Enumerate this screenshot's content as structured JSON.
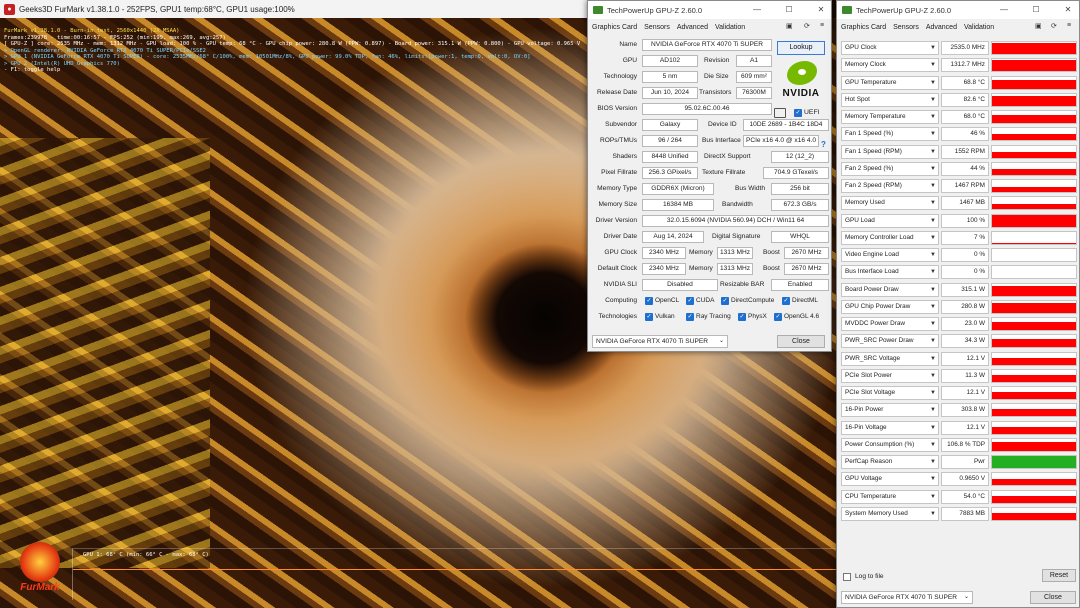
{
  "furmark": {
    "title": "Geeks3D FurMark v1.38.1.0 - 252FPS, GPU1 temp:68°C, GPU1 usage:100%",
    "overlay": [
      "FurMark v1.38.1.0 - Burn-in test, 2560x1440 (2X MSAA)",
      "Frames:239978 - time:00:16:57 - FPS:252 (min:199, max:269, avg:257)",
      "[ GPU-Z ] core: 2535 MHz - mem: 1312 MHz - GPU load: 100 % - GPU temp: 68 °C - GPU chip power: 280.8 W (PPW: 0.897) - Board power: 315.1 W (PPW: 0.800) - GPU voltage: 0.965 V",
      "> OpenGL renderer: NVIDIA GeForce RTX 4070 Ti SUPER/PCIe/SSE2",
      "> GPU 1 (NVIDIA GeForce RTX 4070 Ti SUPER) - core: 2535MHz/68° C/100%, mem: 10501MHz/8%, GPU power: 99.0% TDP, fan: 46%, limits:[power:1, temp:0, volt:0, OV:0]",
      "> GPU 2 (Intel(R) UHD Graphics 770)",
      "- F1: toggle help"
    ],
    "graph_label": "GPU 1: 68° C (min: 66° C - max: 68° C)",
    "logo_text": "FurMark"
  },
  "gpuz_card": {
    "title": "TechPowerUp GPU-Z 2.60.0",
    "tabs": [
      "Graphics Card",
      "Sensors",
      "Advanced",
      "Validation"
    ],
    "lookup": "Lookup",
    "nvidia": "NVIDIA",
    "uefi": "UEFI",
    "labels": {
      "name": "Name",
      "gpu": "GPU",
      "revision": "Revision",
      "technology": "Technology",
      "die_size": "Die Size",
      "release_date": "Release Date",
      "transistors": "Transistors",
      "bios": "BIOS Version",
      "subvendor": "Subvendor",
      "device_id": "Device ID",
      "rops": "ROPs/TMUs",
      "bus_interface": "Bus Interface",
      "shaders": "Shaders",
      "directx": "DirectX Support",
      "pixel_fillrate": "Pixel Fillrate",
      "texture_fillrate": "Texture Fillrate",
      "memory_type": "Memory Type",
      "bus_width": "Bus Width",
      "memory_size": "Memory Size",
      "bandwidth": "Bandwidth",
      "driver_version": "Driver Version",
      "driver_date": "Driver Date",
      "digital_signature": "Digital Signature",
      "gpu_clock": "GPU Clock",
      "memory": "Memory",
      "boost": "Boost",
      "default_clock": "Default Clock",
      "sli": "NVIDIA SLI",
      "resizable_bar": "Resizable BAR",
      "computing": "Computing",
      "technologies": "Technologies"
    },
    "values": {
      "name": "NVIDIA GeForce RTX 4070 Ti SUPER",
      "gpu": "AD102",
      "revision": "A1",
      "technology": "5 nm",
      "die_size": "609 mm²",
      "release_date": "Jun 10, 2024",
      "transistors": "76300M",
      "bios": "95.02.6C.00.46",
      "subvendor": "Galaxy",
      "device_id": "10DE 2689 - 1B4C 18D4",
      "rops": "96 / 264",
      "bus_interface": "PCIe x16 4.0 @ x16 4.0",
      "shaders": "8448 Unified",
      "directx": "12 (12_2)",
      "pixel_fillrate": "256.3 GPixel/s",
      "texture_fillrate": "704.9 GTexel/s",
      "memory_type": "GDDR6X (Micron)",
      "bus_width": "256 bit",
      "memory_size": "16384 MB",
      "bandwidth": "672.3 GB/s",
      "driver_version": "32.0.15.6094 (NVIDIA 560.94) DCH / Win11 64",
      "driver_date": "Aug 14, 2024",
      "digital_signature": "WHQL",
      "gpu_clock": "2340 MHz",
      "memory_clock": "1313 MHz",
      "boost": "2670 MHz",
      "default_gpu_clock": "2340 MHz",
      "default_memory": "1313 MHz",
      "default_boost": "2670 MHz",
      "sli": "Disabled",
      "resizable_bar": "Enabled"
    },
    "computing": [
      "OpenCL",
      "CUDA",
      "DirectCompute",
      "DirectML"
    ],
    "technologies": [
      "Vulkan",
      "Ray Tracing",
      "PhysX",
      "OpenGL 4.6"
    ],
    "selected_gpu": "NVIDIA GeForce RTX 4070 Ti SUPER",
    "close": "Close"
  },
  "gpuz_sensors": {
    "title": "TechPowerUp GPU-Z 2.60.0",
    "tabs": [
      "Graphics Card",
      "Sensors",
      "Advanced",
      "Validation"
    ],
    "graph_color": "#ff0000",
    "perfcap_color": "#22b022",
    "rows": [
      {
        "name": "GPU Clock",
        "value": "2535.0 MHz",
        "level": 0.92
      },
      {
        "name": "Memory Clock",
        "value": "1312.7 MHz",
        "level": 0.92
      },
      {
        "name": "GPU Temperature",
        "value": "68.8 °C",
        "level": 0.7
      },
      {
        "name": "Hot Spot",
        "value": "82.6 °C",
        "level": 0.8
      },
      {
        "name": "Memory Temperature",
        "value": "68.0 °C",
        "level": 0.7
      },
      {
        "name": "Fan 1 Speed (%)",
        "value": "46 %",
        "level": 0.5
      },
      {
        "name": "Fan 1 Speed (RPM)",
        "value": "1552 RPM",
        "level": 0.5
      },
      {
        "name": "Fan 2 Speed (%)",
        "value": "44 %",
        "level": 0.45
      },
      {
        "name": "Fan 2 Speed (RPM)",
        "value": "1467 RPM",
        "level": 0.45
      },
      {
        "name": "Memory Used",
        "value": "1467 MB",
        "level": 0.45
      },
      {
        "name": "GPU Load",
        "value": "100 %",
        "level": 0.95
      },
      {
        "name": "Memory Controller Load",
        "value": "7 %",
        "level": 0.1
      },
      {
        "name": "Video Engine Load",
        "value": "0 %",
        "level": 0
      },
      {
        "name": "Bus Interface Load",
        "value": "0 %",
        "level": 0
      },
      {
        "name": "Board Power Draw",
        "value": "315.1 W",
        "level": 0.8
      },
      {
        "name": "GPU Chip Power Draw",
        "value": "280.8 W",
        "level": 0.8
      },
      {
        "name": "MVDDC Power Draw",
        "value": "23.0 W",
        "level": 0.7
      },
      {
        "name": "PWR_SRC Power Draw",
        "value": "34.3 W",
        "level": 0.7
      },
      {
        "name": "PWR_SRC Voltage",
        "value": "12.1 V",
        "level": 0.55
      },
      {
        "name": "PCIe Slot Power",
        "value": "11.3 W",
        "level": 0.55
      },
      {
        "name": "PCIe Slot Voltage",
        "value": "12.1 V",
        "level": 0.55
      },
      {
        "name": "16-Pin Power",
        "value": "303.8 W",
        "level": 0.6
      },
      {
        "name": "16-Pin Voltage",
        "value": "12.1 V",
        "level": 0.55
      },
      {
        "name": "Power Consumption (%)",
        "value": "106.8 % TDP",
        "level": 0.7
      },
      {
        "name": "PerfCap Reason",
        "value": "Pwr",
        "level": 1.0,
        "perfcap": true
      },
      {
        "name": "GPU Voltage",
        "value": "0.9650 V",
        "level": 0.55
      },
      {
        "name": "CPU Temperature",
        "value": "54.0 °C",
        "level": 0.55
      },
      {
        "name": "System Memory Used",
        "value": "7883 MB",
        "level": 0.55
      }
    ],
    "log_to_file": "Log to file",
    "reset": "Reset",
    "selected_gpu": "NVIDIA GeForce RTX 4070 Ti SUPER",
    "close": "Close"
  }
}
